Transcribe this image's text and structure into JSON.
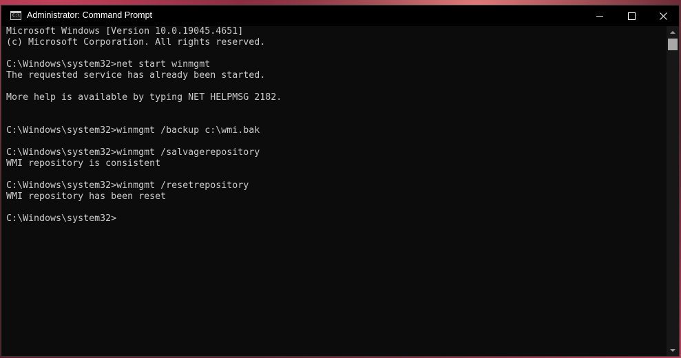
{
  "window": {
    "title": "Administrator: Command Prompt",
    "icon": "cmd-icon",
    "icon_text": "C:\\"
  },
  "controls": {
    "minimize_icon": "minimize-icon",
    "maximize_icon": "maximize-icon",
    "close_icon": "close-icon",
    "close_glyph": "✕"
  },
  "console": {
    "lines": [
      "Microsoft Windows [Version 10.0.19045.4651]",
      "(c) Microsoft Corporation. All rights reserved.",
      "",
      "C:\\Windows\\system32>net start winmgmt",
      "The requested service has already been started.",
      "",
      "More help is available by typing NET HELPMSG 2182.",
      "",
      "",
      "C:\\Windows\\system32>winmgmt /backup c:\\wmi.bak",
      "",
      "C:\\Windows\\system32>winmgmt /salvagerepository",
      "WMI repository is consistent",
      "",
      "C:\\Windows\\system32>winmgmt /resetrepository",
      "WMI repository has been reset",
      "",
      "C:\\Windows\\system32>"
    ]
  },
  "colors": {
    "console_bg": "#0c0c0c",
    "console_text": "#cccccc",
    "titlebar_bg": "#000000"
  }
}
